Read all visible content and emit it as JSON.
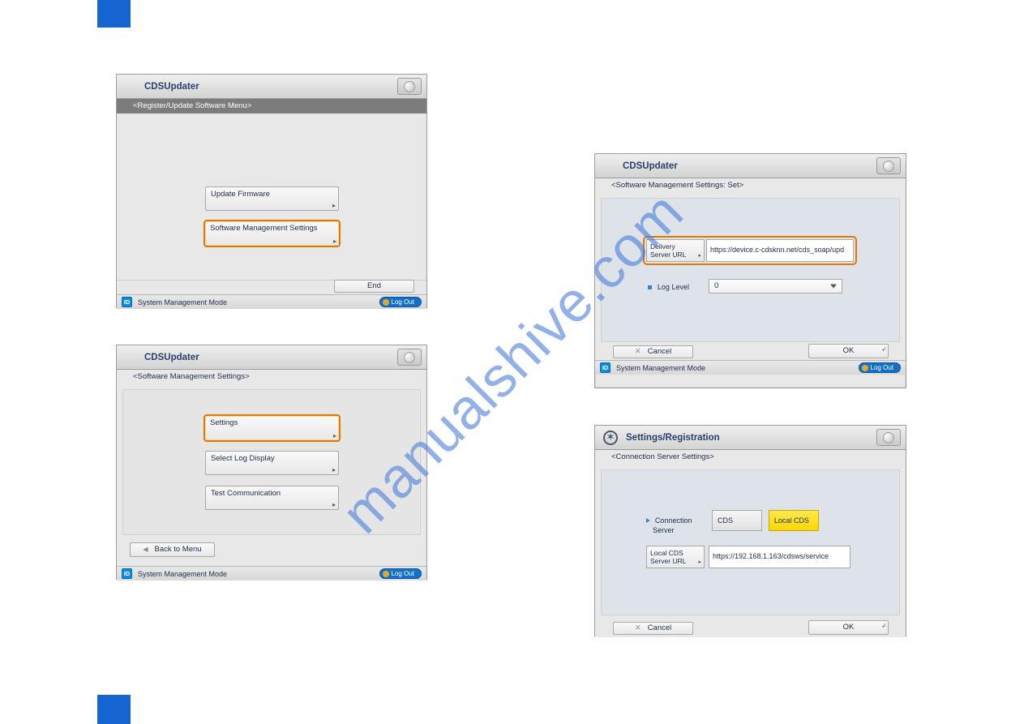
{
  "watermark": "manualshive.com",
  "panel1": {
    "title": "CDSUpdater",
    "breadcrumb": "<Register/Update Software Menu>",
    "btn_update_fw": "Update Firmware",
    "btn_sw_mgmt": "Software Management Settings",
    "end": "End",
    "mode": "System Management Mode",
    "logout": "Log Out"
  },
  "panel2": {
    "title": "CDSUpdater",
    "breadcrumb": "<Software Management Settings>",
    "btn_settings": "Settings",
    "btn_log": "Select Log Display",
    "btn_test": "Test Communication",
    "back": "Back to Menu",
    "mode": "System Management Mode",
    "logout": "Log Out"
  },
  "panel3": {
    "title": "CDSUpdater",
    "breadcrumb": "<Software Management Settings: Set>",
    "url_label_l1": "Delivery",
    "url_label_l2": "Server URL",
    "url_value": "https://device.c-cdsknn.net/cds_soap/upd",
    "loglevel_label": "Log Level",
    "loglevel_value": "0",
    "cancel": "Cancel",
    "ok": "OK",
    "mode": "System Management Mode",
    "logout": "Log Out"
  },
  "panel4": {
    "title": "Settings/Registration",
    "breadcrumb": "<Connection Server Settings>",
    "conn_label_l1": "Connection",
    "conn_label_l2": "Server",
    "opt_cds": "CDS",
    "opt_local": "Local CDS",
    "url_label_l1": "Local CDS",
    "url_label_l2": "Server URL",
    "url_value": "https://192.168.1.163/cdsws/service",
    "cancel": "Cancel",
    "ok": "OK"
  },
  "id_badge": "ID"
}
